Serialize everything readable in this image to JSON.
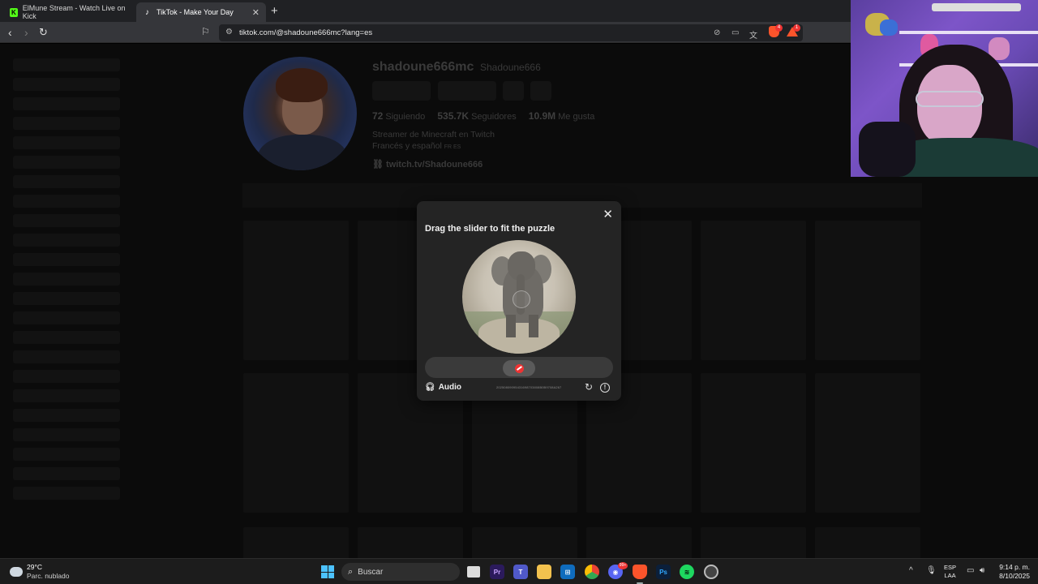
{
  "browser": {
    "tabs": [
      {
        "label": "ElMune Stream - Watch Live on Kick",
        "favicon": "K"
      },
      {
        "label": "TikTok - Make Your Day",
        "favicon": "♪"
      }
    ],
    "new_tab_label": "+",
    "close_glyph": "✕",
    "url": "tiktok.com/@shadoune666mc?lang=es",
    "extension_badge": "4",
    "rewards_badge": "1"
  },
  "profile": {
    "username": "shadoune666mc",
    "nickname": "Shadoune666",
    "stats": [
      {
        "value": "72",
        "label": "Siguiendo"
      },
      {
        "value": "535.7K",
        "label": "Seguidores"
      },
      {
        "value": "10.9M",
        "label": "Me gusta"
      }
    ],
    "bio_line1": "Streamer de Minecraft en Twitch",
    "bio_line2": "Francés y español",
    "bio_line2_small": "FR ES",
    "link": "twitch.tv/Shadoune666"
  },
  "captcha": {
    "title": "Drag the slider to fit the puzzle",
    "close_glyph": "✕",
    "audio_label": "Audio",
    "captcha_id": "20250809095431698703808B0B9708A267",
    "slider_position": 0.5
  },
  "taskbar": {
    "temperature": "29°C",
    "condition": "Parc. nublado",
    "search_placeholder": "Buscar",
    "language_line1": "ESP",
    "language_line2": "LAA",
    "time": "9:14 p. m.",
    "date": "8/10/2025",
    "discord_badge": "99+",
    "apps": [
      "file-explorer",
      "premiere-pro",
      "teams",
      "folder",
      "store",
      "chrome",
      "discord",
      "brave",
      "photoshop",
      "spotify",
      "chrome-canary"
    ]
  },
  "colors": {
    "kick_green": "#53fc18",
    "brave_orange": "#fb542b",
    "windows_blue": "#4cc2ff"
  }
}
